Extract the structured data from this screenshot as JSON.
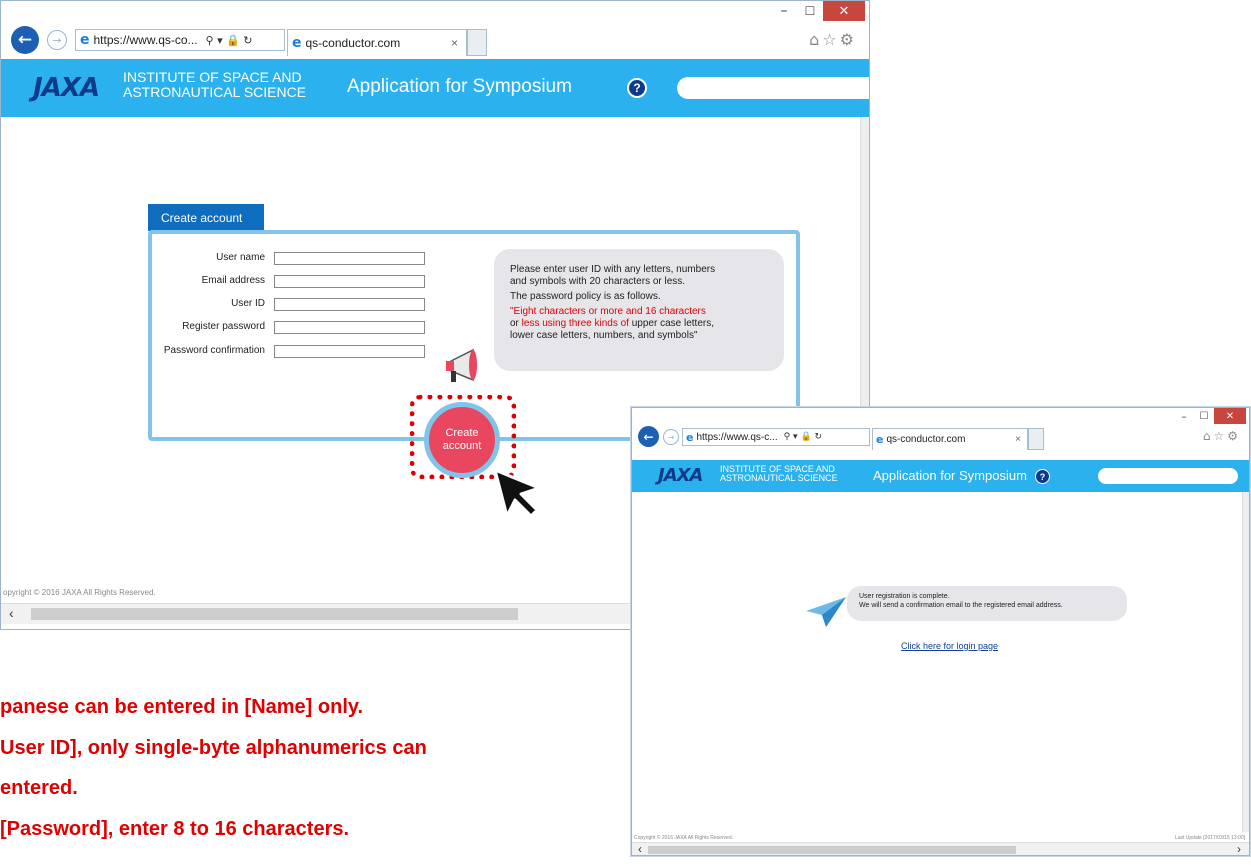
{
  "colors": {
    "header_band": "#2bb2ee",
    "logo": "#0d3a8a",
    "tab_header": "#0f6dbf",
    "panel_border": "#82c3ea",
    "create_button": "#e8475f",
    "highlight": "#e10000",
    "close_button": "#c7463d"
  },
  "window_main": {
    "url": "https://www.qs-co...",
    "tab_title": "qs-conductor.com",
    "address_icons": [
      "search-icon",
      "dropdown-icon",
      "lock-icon",
      "refresh-icon"
    ],
    "toolbar_icons": [
      "home-icon",
      "favorites-icon",
      "settings-icon"
    ],
    "header": {
      "logo": "JAXA",
      "institute_line1": "INSTITUTE OF SPACE AND",
      "institute_line2": "ASTRONAUTICAL SCIENCE",
      "app_title": "Application for Symposium",
      "help": "?"
    },
    "form": {
      "tab_label": "Create account",
      "fields": [
        {
          "label": "User name",
          "value": ""
        },
        {
          "label": "Email address",
          "value": ""
        },
        {
          "label": "User ID",
          "value": ""
        },
        {
          "label": "Register password",
          "value": ""
        },
        {
          "label": "Password confirmation",
          "value": ""
        }
      ],
      "bubble": {
        "line1": "Please enter user ID with any letters, numbers",
        "line2": "and symbols with 20 characters or less.",
        "line3": "The password policy is as follows.",
        "line4_red": "\"Eight characters or more and 16 characters",
        "line5_prefix": "or ",
        "line5_red": "less using three kinds of",
        "line5_suffix": " upper case letters,",
        "line6": "lower case letters, numbers, and symbols\""
      },
      "button_line1": "Create",
      "button_line2": "account"
    },
    "footer": "opyright © 2016 JAXA All Rights Reserved."
  },
  "window_complete": {
    "url": "https://www.qs-c...",
    "tab_title": "qs-conductor.com",
    "header": {
      "logo": "JAXA",
      "institute_line1": "INSTITUTE OF SPACE AND",
      "institute_line2": "ASTRONAUTICAL SCIENCE",
      "app_title": "Application for Symposium",
      "help": "?"
    },
    "message_line1": "User registration is complete.",
    "message_line2": "We will send a confirmation email to the registered email address.",
    "login_link": "Click here for login page",
    "footer_left": "Copyright © 2016 JAXA All Rights Reserved.",
    "footer_right": "Last Update [2017/03/15 13:00]"
  },
  "notes": [
    "panese can be entered in [Name] only.",
    "User ID], only single-byte alphanumerics can",
    "entered.",
    "[Password], enter 8 to 16 characters."
  ]
}
